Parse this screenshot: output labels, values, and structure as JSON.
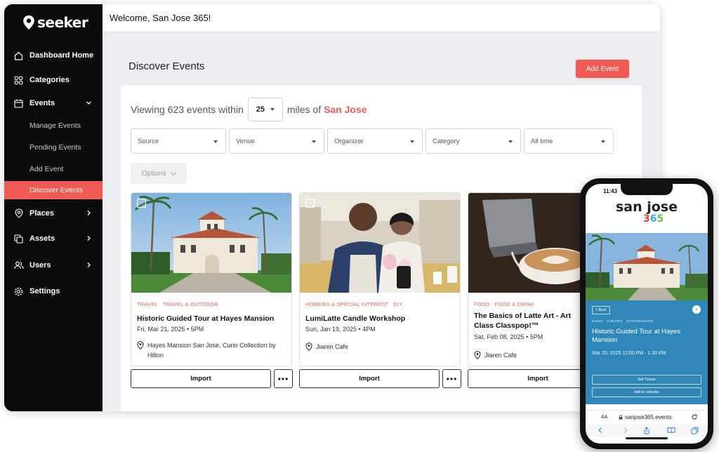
{
  "app": {
    "name": "seeker"
  },
  "sidebar": {
    "items": [
      {
        "label": "Dashboard Home"
      },
      {
        "label": "Categories"
      },
      {
        "label": "Events"
      },
      {
        "label": "Places"
      },
      {
        "label": "Assets"
      },
      {
        "label": "Users"
      },
      {
        "label": "Settings"
      }
    ],
    "events_subitems": [
      {
        "label": "Manage Events"
      },
      {
        "label": "Pending Events"
      },
      {
        "label": "Add Event"
      },
      {
        "label": "Discover Events",
        "active": true
      }
    ]
  },
  "topbar": {
    "welcome": "Welcome, San Jose 365!"
  },
  "main": {
    "title": "Discover Events",
    "add_button": "Add Event",
    "viewing_prefix": "Viewing 623 events within",
    "miles_value": "25",
    "miles_suffix": "miles of",
    "city": "San Jose",
    "filters": [
      "Source",
      "Venue",
      "Organizer",
      "Category",
      "All time"
    ],
    "options_label": "Options"
  },
  "events": [
    {
      "tags": [
        "TRAVEL",
        "TRAVEL & OUTDOOR"
      ],
      "title": "Historic Guided Tour at Hayes Mansion",
      "date": "Fri, Mar 21, 2025 • 5PM",
      "location": "Hayes Mansion San Jose, Curio Collection by Hilton",
      "import_label": "Import",
      "more_label": "•••"
    },
    {
      "tags": [
        "HOBBIES & SPECIAL INTEREST",
        "DIY"
      ],
      "title": "LumiLatte Candle Workshop",
      "date": "Sun, Jan 19, 2025 • 4PM",
      "location": "Jiaren Cafe",
      "import_label": "Import",
      "more_label": "•••"
    },
    {
      "tags": [
        "FOOD",
        "FOOD & DRINK"
      ],
      "title": "The Basics of Latte Art - Art Class Classpop!™",
      "date": "Sat, Feb 08, 2025 • 5PM",
      "location": "Jiaren Cafe",
      "import_label": "Import"
    }
  ],
  "phone": {
    "time": "11:43",
    "logo_text": "san jose",
    "logo_digits": [
      "3",
      "6",
      "5"
    ],
    "back_label": "< Back",
    "close_label": "×",
    "tags": [
      "EVENT",
      "CURATED",
      "HAYESMANSION"
    ],
    "event_title": "Historic Guided Tour at Hayes Mansion",
    "event_date": "Mar 20, 2025 12:00 PM - 1:30 PM",
    "get_tickets": "Get Tickets",
    "add_calendar": "Add to calendar",
    "aa_label": "AA",
    "url": "sanjose365.events"
  },
  "colors": {
    "accent": "#ef5a55",
    "sidebar": "#0c0c0c",
    "phone_panel": "#2f86b8"
  }
}
